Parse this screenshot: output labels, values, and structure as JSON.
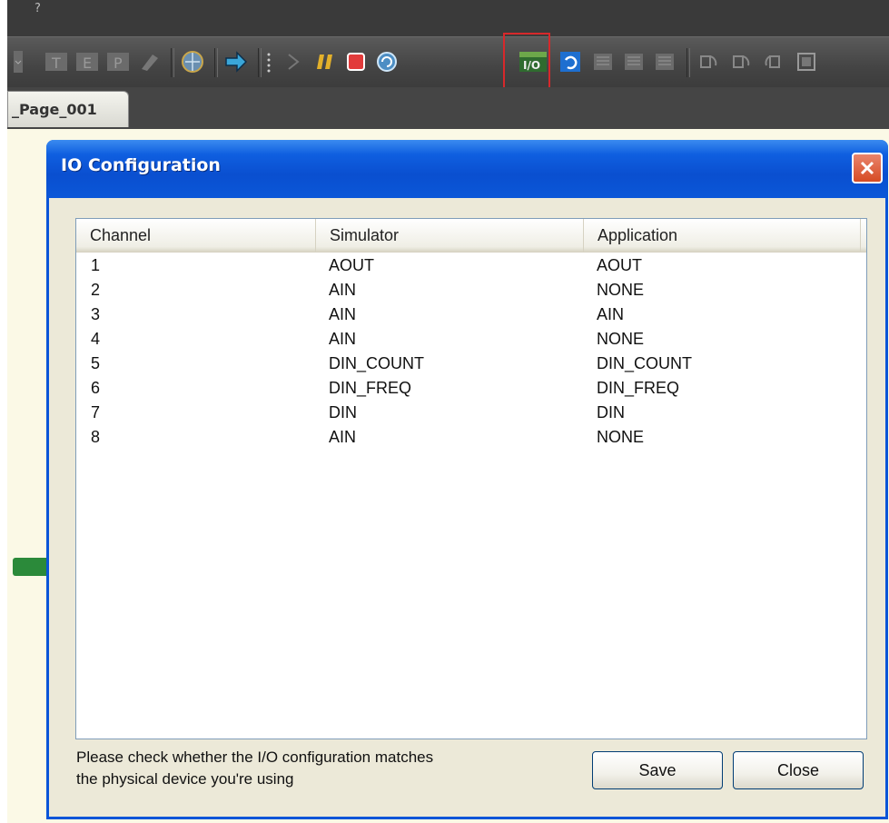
{
  "menu": {
    "help_label": "?"
  },
  "toolbar": {
    "icons": [
      "t-icon",
      "e-icon",
      "p-icon",
      "eraser-icon",
      "globe-icon",
      "arrow-right-icon",
      "step-icon",
      "pause-icon",
      "stop-icon",
      "refresh-icon",
      "io-config-icon",
      "undo-icon",
      "indent-icon",
      "outdent-icon",
      "align-icon",
      "rotate-icon",
      "rotate2-icon",
      "rotate3-icon",
      "fit-icon"
    ],
    "io_label": "I/O"
  },
  "tabs": [
    {
      "label": "_Page_001"
    }
  ],
  "dialog": {
    "title": "IO Configuration",
    "columns": [
      "Channel",
      "Simulator",
      "Application"
    ],
    "rows": [
      [
        "1",
        "AOUT",
        "AOUT"
      ],
      [
        "2",
        "AIN",
        "NONE"
      ],
      [
        "3",
        "AIN",
        "AIN"
      ],
      [
        "4",
        "AIN",
        "NONE"
      ],
      [
        "5",
        "DIN_COUNT",
        "DIN_COUNT"
      ],
      [
        "6",
        "DIN_FREQ",
        "DIN_FREQ"
      ],
      [
        "7",
        "DIN",
        "DIN"
      ],
      [
        "8",
        "AIN",
        "NONE"
      ]
    ],
    "note_line1": "Please check whether the I/O configuration matches",
    "note_line2": "the physical device you're using",
    "save_label": "Save",
    "close_label": "Close"
  },
  "colors": {
    "titlebar": "#0a4fd0",
    "highlight": "#d7282b"
  }
}
